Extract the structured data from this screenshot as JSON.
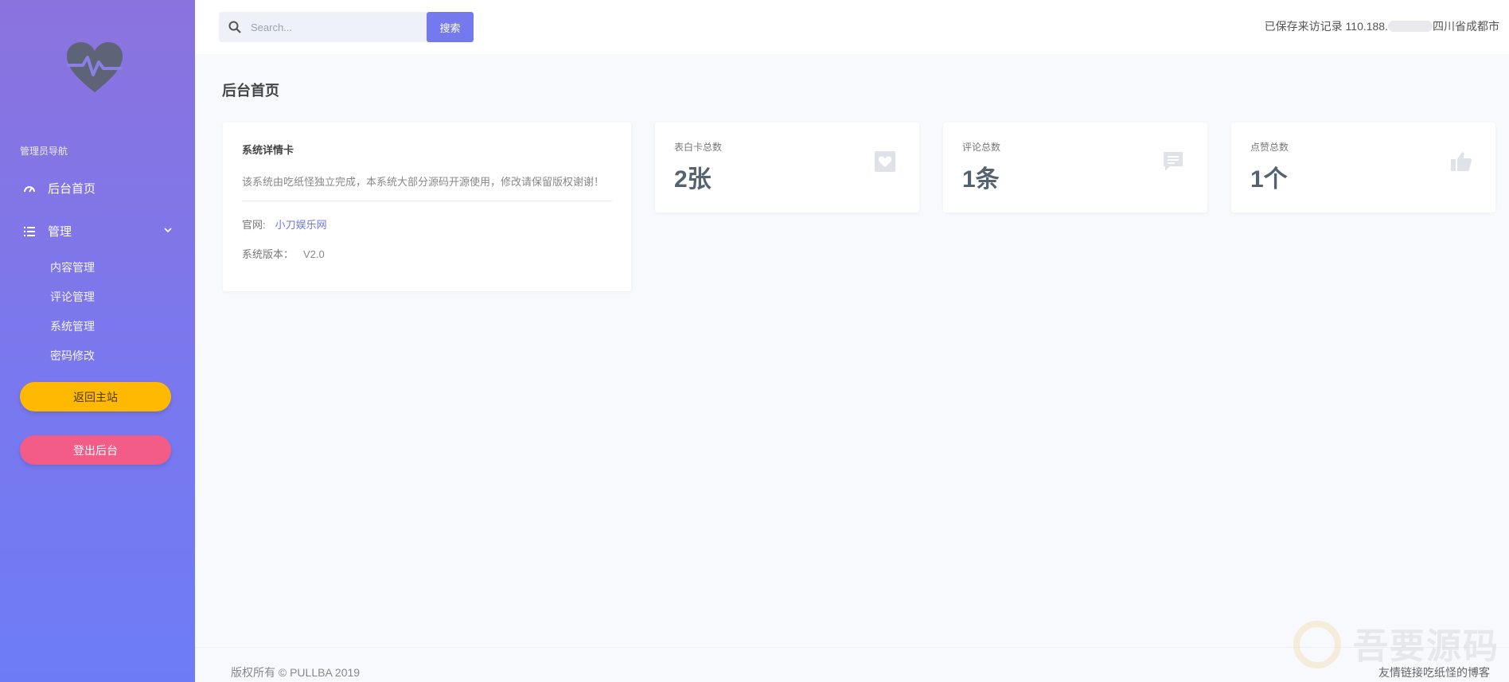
{
  "sidebar": {
    "heading": "管理员导航",
    "home_label": "后台首页",
    "manage_label": "管理",
    "sub_items": [
      "内容管理",
      "评论管理",
      "系统管理",
      "密码修改"
    ],
    "back_button": "返回主站",
    "logout_button": "登出后台"
  },
  "header": {
    "search_placeholder": "Search...",
    "search_button": "搜索",
    "visit_prefix": "已保存来访记录 110.188.",
    "visit_suffix": "四川省成都市"
  },
  "main": {
    "page_title": "后台首页",
    "info_card": {
      "title": "系统详情卡",
      "description": "该系统由吃纸怪独立完成，本系统大部分源码开源使用，修改请保留版权谢谢！",
      "site_label": "官网:",
      "site_link": "小刀娱乐网",
      "version_label": "系统版本：",
      "version_value": "V2.0"
    },
    "stats": [
      {
        "label": "表白卡总数",
        "value": "2张",
        "icon": "heart-card-icon"
      },
      {
        "label": "评论总数",
        "value": "1条",
        "icon": "comment-icon"
      },
      {
        "label": "点赞总数",
        "value": "1个",
        "icon": "thumbs-up-icon"
      }
    ]
  },
  "footer": {
    "copyright": "版权所有 © PULLBA 2019",
    "friend_link": "友情链接吃纸怪的博客"
  },
  "watermark": {
    "text": "吾要源码"
  },
  "colors": {
    "sidebar_top": "#8b73de",
    "sidebar_bottom": "#6d7cf6",
    "accent": "#7579ee",
    "back_button": "#ffb900",
    "logout_button": "#f35c86"
  }
}
